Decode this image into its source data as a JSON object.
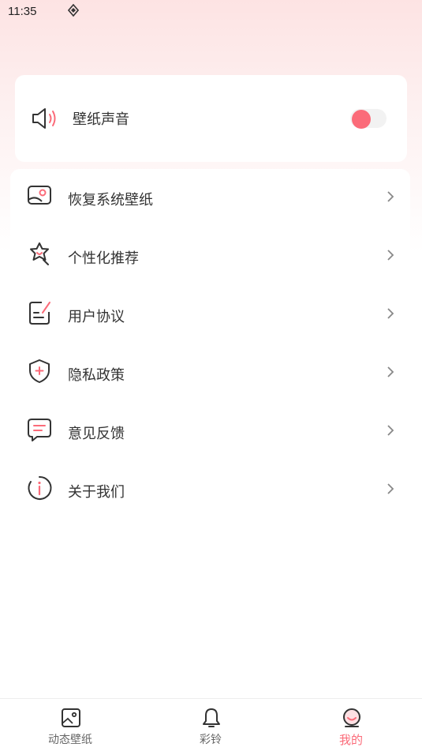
{
  "status_bar": {
    "time": "11:35"
  },
  "sound_setting": {
    "label": "壁纸声音",
    "enabled": true,
    "icon": "speaker-icon"
  },
  "menu": [
    {
      "label": "恢复系统壁纸",
      "icon": "restore-wallpaper-icon"
    },
    {
      "label": "个性化推荐",
      "icon": "personalize-icon"
    },
    {
      "label": "用户协议",
      "icon": "document-icon"
    },
    {
      "label": "隐私政策",
      "icon": "shield-icon"
    },
    {
      "label": "意见反馈",
      "icon": "feedback-icon"
    },
    {
      "label": "关于我们",
      "icon": "info-icon"
    }
  ],
  "bottom_nav": [
    {
      "label": "动态壁纸",
      "icon": "image-icon",
      "active": false
    },
    {
      "label": "彩铃",
      "icon": "bell-icon",
      "active": false
    },
    {
      "label": "我的",
      "icon": "profile-icon",
      "active": true
    }
  ],
  "colors": {
    "accent": "#fb6b79",
    "text": "#333333",
    "icon": "#333333"
  }
}
